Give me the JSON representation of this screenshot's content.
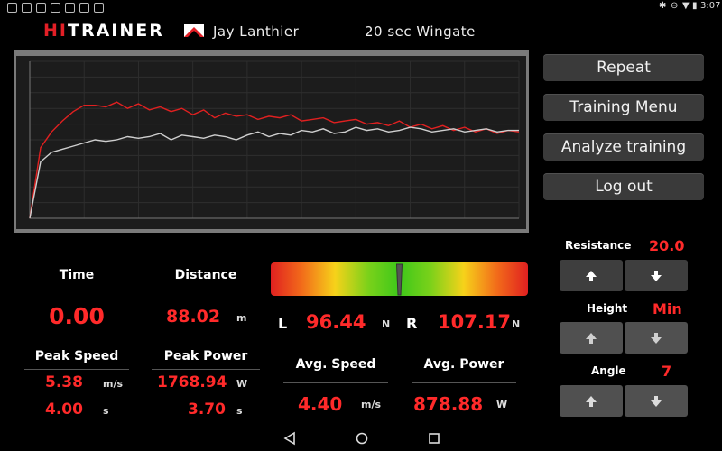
{
  "statusbar": {
    "time": "3:07"
  },
  "header": {
    "brand_hi": "HI",
    "brand_trainer": "TRAINER",
    "user_name": "Jay Lanthier",
    "program": "20 sec Wingate"
  },
  "chart_data": {
    "type": "line",
    "title": "",
    "xlabel": "",
    "ylabel": "",
    "series": [
      {
        "color": "#e02020",
        "values": [
          0.0,
          0.45,
          0.55,
          0.62,
          0.68,
          0.72,
          0.72,
          0.71,
          0.74,
          0.7,
          0.73,
          0.69,
          0.71,
          0.68,
          0.7,
          0.66,
          0.69,
          0.64,
          0.67,
          0.65,
          0.66,
          0.63,
          0.65,
          0.64,
          0.66,
          0.62,
          0.63,
          0.64,
          0.61,
          0.62,
          0.63,
          0.6,
          0.61,
          0.59,
          0.62,
          0.58,
          0.6,
          0.57,
          0.59,
          0.56,
          0.58,
          0.55,
          0.57,
          0.54,
          0.56,
          0.55
        ]
      },
      {
        "color": "#cfcfcf",
        "values": [
          0.0,
          0.36,
          0.42,
          0.44,
          0.46,
          0.48,
          0.5,
          0.49,
          0.5,
          0.52,
          0.51,
          0.52,
          0.54,
          0.5,
          0.53,
          0.52,
          0.51,
          0.53,
          0.52,
          0.5,
          0.53,
          0.55,
          0.52,
          0.54,
          0.53,
          0.56,
          0.55,
          0.57,
          0.54,
          0.55,
          0.58,
          0.56,
          0.57,
          0.55,
          0.56,
          0.58,
          0.57,
          0.55,
          0.56,
          0.57,
          0.55,
          0.56,
          0.57,
          0.55,
          0.56,
          0.56
        ]
      }
    ]
  },
  "menu": {
    "repeat": "Repeat",
    "training_menu": "Training Menu",
    "analyze": "Analyze training",
    "logout": "Log out"
  },
  "stats": {
    "time_label": "Time",
    "time_value": "0.00",
    "distance_label": "Distance",
    "distance_value": "88.02",
    "distance_unit": "m",
    "peak_speed_label": "Peak Speed",
    "peak_speed_value": "5.38",
    "peak_speed_unit": "m/s",
    "peak_speed_time": "4.00",
    "peak_speed_time_unit": "s",
    "peak_power_label": "Peak Power",
    "peak_power_value": "1768.94",
    "peak_power_unit": "W",
    "peak_power_time": "3.70",
    "peak_power_time_unit": "s"
  },
  "balance": {
    "left_label": "L",
    "left_value": "96.44",
    "left_unit": "N",
    "right_label": "R",
    "right_value": "107.17",
    "right_unit": "N",
    "indicator_position": 0.5
  },
  "averages": {
    "avg_speed_label": "Avg. Speed",
    "avg_speed_value": "4.40",
    "avg_speed_unit": "m/s",
    "avg_power_label": "Avg. Power",
    "avg_power_value": "878.88",
    "avg_power_unit": "W"
  },
  "controls": {
    "resistance_label": "Resistance",
    "resistance_value": "20.0",
    "height_label": "Height",
    "height_value": "Min",
    "angle_label": "Angle",
    "angle_value": "7"
  }
}
